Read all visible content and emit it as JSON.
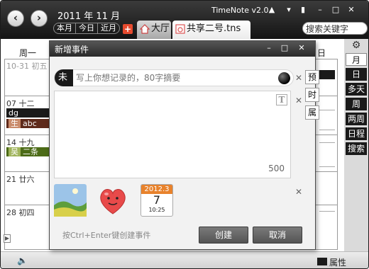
{
  "app": {
    "brand": "TimeNote v2.0",
    "date_title": "2011 年 11 月",
    "range_buttons": [
      "本月",
      "今日",
      "近月"
    ],
    "tabs": [
      {
        "label": "大厅"
      },
      {
        "label": "共享二号.tns"
      }
    ],
    "search": {
      "value": "搜索关键字"
    }
  },
  "calendar": {
    "header_left": "周一",
    "header_right": "日",
    "rows": [
      {
        "date": "10-31 初五",
        "muted": true
      },
      {
        "date": "07 十二",
        "muted": false
      },
      {
        "date": "14 十九",
        "muted": false
      },
      {
        "date": "21 廿六",
        "muted": false
      },
      {
        "date": "28 初四",
        "muted": false
      }
    ],
    "events": [
      {
        "text": "dg",
        "tag": "",
        "style": "black"
      },
      {
        "text": "abc",
        "tag": "生",
        "style": "brown"
      },
      {
        "text": "二条",
        "tag": "吴",
        "style": "olive"
      }
    ]
  },
  "right_strip": {
    "buttons": [
      "月",
      "日",
      "多天",
      "周",
      "两周",
      "日程",
      "搜索"
    ],
    "active": "月"
  },
  "bottom": {
    "property_label": "属性"
  },
  "dialog": {
    "title": "新增事件",
    "summary_badge": "未",
    "summary_placeholder": "写上你想记录的，80字摘要",
    "char_limit": "500",
    "side_tabs": [
      "预",
      "时",
      "属"
    ],
    "text_button": "T",
    "calendar_icon": {
      "month": "2012.3",
      "day": "7",
      "time": "10:25"
    },
    "hint": "按Ctrl+Enter键创建事件",
    "create_label": "创建",
    "cancel_label": "取消"
  },
  "colors": {
    "topbar": "#1a1a1a",
    "event_brown": "#5e2a1b",
    "event_olive": "#4c6b17",
    "accent": "#e64a2e"
  }
}
